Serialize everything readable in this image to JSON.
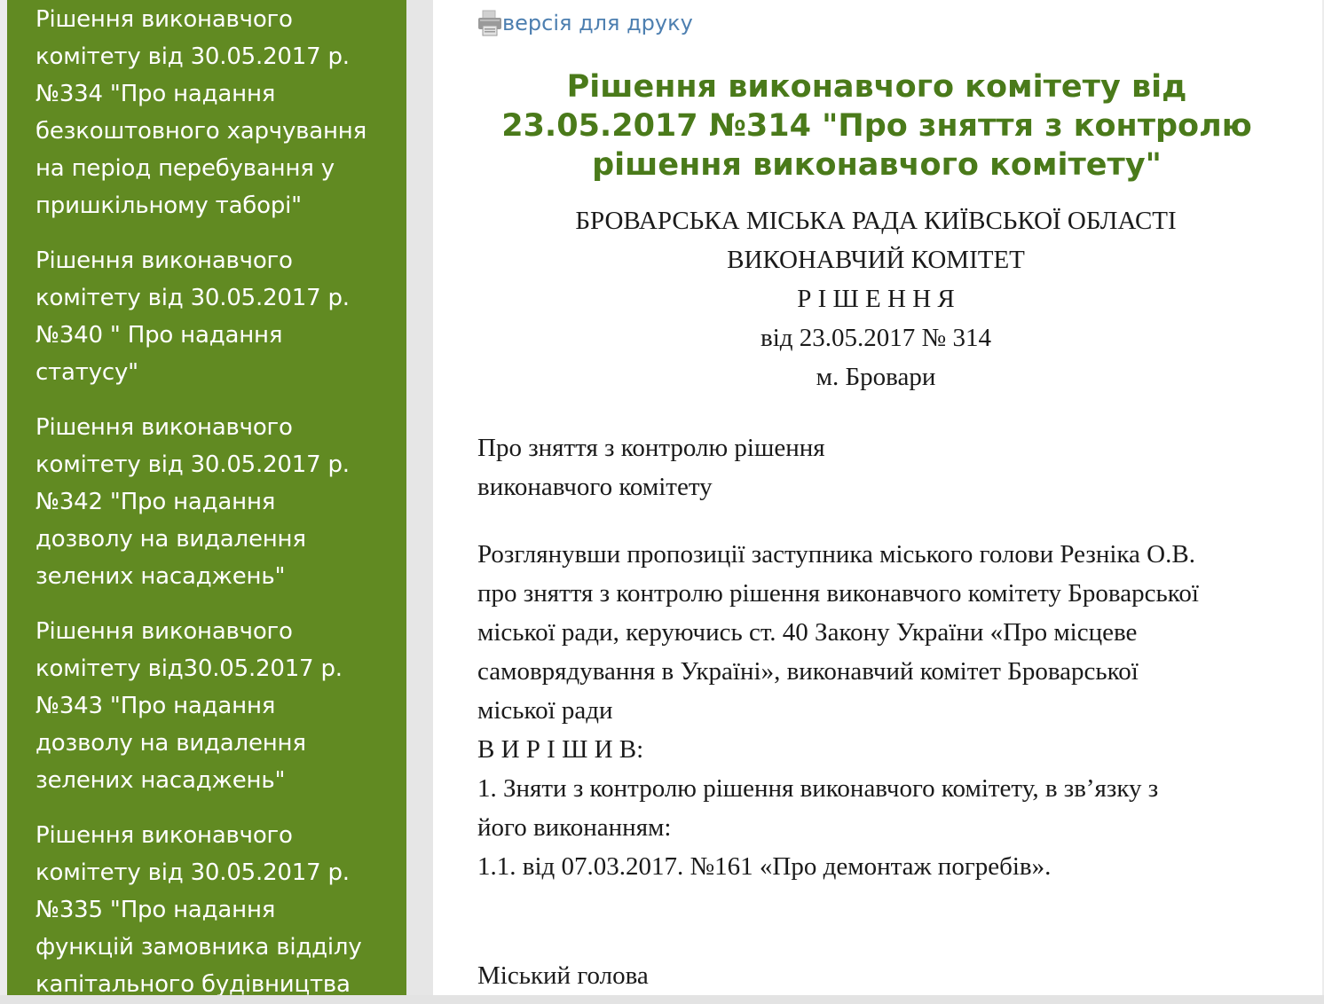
{
  "sidebar": {
    "items": [
      {
        "lines": [
          "Рішення виконавчого",
          "комітету від 30.05.2017 р.",
          "№334 \"Про надання",
          "безкоштовного харчування",
          "на період перебування у",
          "пришкільному таборі\""
        ]
      },
      {
        "lines": [
          "Рішення виконавчого",
          "комітету від 30.05.2017 р.",
          "№340 \" Про надання",
          "статусу\""
        ]
      },
      {
        "lines": [
          "Рішення виконавчого",
          "комітету від 30.05.2017 р.",
          "№342 \"Про надання",
          "дозволу на видалення",
          "зелених насаджень\""
        ]
      },
      {
        "lines": [
          "Рішення виконавчого",
          "комітету від30.05.2017 р.",
          "№343 \"Про надання",
          "дозволу на видалення",
          "зелених насаджень\""
        ]
      },
      {
        "lines": [
          "Рішення виконавчого",
          "комітету від 30.05.2017 р.",
          "№335 \"Про надання",
          "функцій замовника відділу",
          "капітального будівництва"
        ]
      }
    ]
  },
  "content": {
    "print_link": "версія для друку",
    "title_lines": [
      "Рішення виконавчого комітету від",
      "23.05.2017 №314 \"Про зняття з контролю",
      "рішення виконавчого комітету\""
    ],
    "header": {
      "council": "БРОВАРСЬКА МІСЬКА РАДА КИЇВСЬКОЇ ОБЛАСТІ",
      "committee": "ВИКОНАВЧИЙ КОМІТЕТ",
      "decision": "Р І Ш Е Н Н Я",
      "date_number": "від 23.05.2017 № 314",
      "city": "м. Бровари"
    },
    "subject_lines": [
      "Про зняття з контролю рішення",
      "виконавчого комітету"
    ],
    "preamble_lines": [
      "Розглянувши пропозиції заступника міського голови Резніка О.В.",
      "про зняття з контролю рішення виконавчого комітету Броварської",
      "міської ради, керуючись ст. 40 Закону України «Про місцеве",
      "самоврядування в Україні», виконавчий комітет Броварської",
      "міської ради"
    ],
    "resolved": "В И Р І Ш И В:",
    "item1_lines": [
      "1. Зняти з контролю рішення виконавчого комітету, в зв’язку з",
      "його виконанням:"
    ],
    "item1_1": "1.1. від 07.03.2017. №161 «Про демонтаж погребів».",
    "mayor": "Міський голова"
  },
  "icons": {
    "print": "printer-icon"
  },
  "colors": {
    "sidebar_bg": "#618a22",
    "title": "#4a7a1a",
    "link": "#4d7fb0"
  }
}
